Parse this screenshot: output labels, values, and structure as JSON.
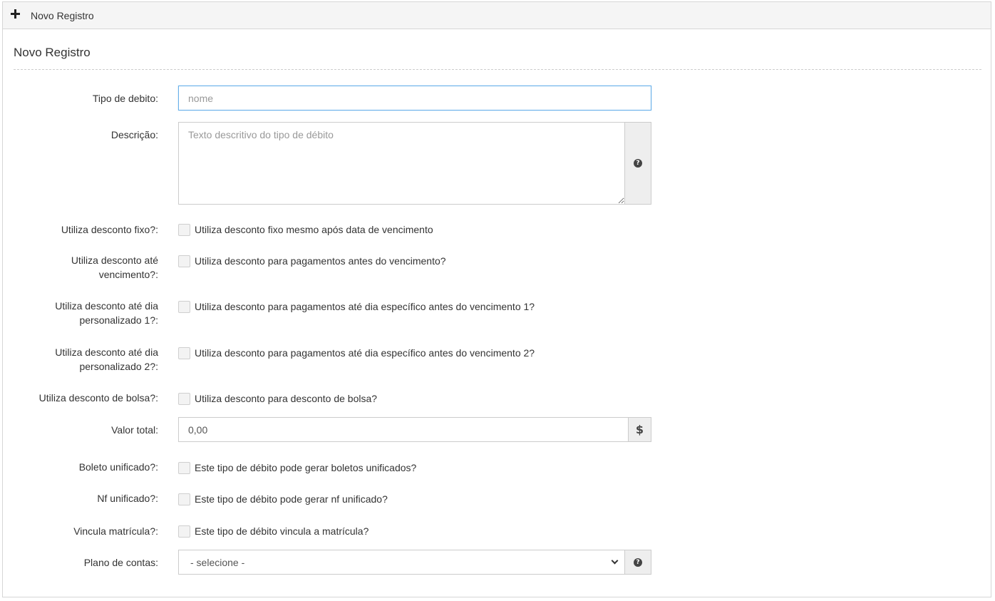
{
  "header": {
    "title": "Novo Registro",
    "icon": "plus-icon"
  },
  "section": {
    "title": "Novo Registro"
  },
  "fields": {
    "tipo_debito": {
      "label": "Tipo de debito:",
      "placeholder": "nome"
    },
    "descricao": {
      "label": "Descrição:",
      "placeholder": "Texto descritivo do tipo de débito",
      "addon_icon": "help-icon"
    },
    "desconto_fixo": {
      "label": "Utiliza desconto fixo?:",
      "text": "Utiliza desconto fixo mesmo após data de vencimento",
      "checked": false
    },
    "desconto_vencimento": {
      "label_line1": "Utiliza desconto até",
      "label_line2": "vencimento?:",
      "text": "Utiliza desconto para pagamentos antes do vencimento?",
      "checked": false
    },
    "desconto_dia1": {
      "label_line1": "Utiliza desconto até dia",
      "label_line2": "personalizado 1?:",
      "text": "Utiliza desconto para pagamentos até dia específico antes do vencimento 1?",
      "checked": false
    },
    "desconto_dia2": {
      "label_line1": "Utiliza desconto até dia",
      "label_line2": "personalizado 2?:",
      "text": "Utiliza desconto para pagamentos até dia específico antes do vencimento 2?",
      "checked": false
    },
    "desconto_bolsa": {
      "label": "Utiliza desconto de bolsa?:",
      "text": "Utiliza desconto para desconto de bolsa?",
      "checked": false
    },
    "valor_total": {
      "label": "Valor total:",
      "value": "0,00",
      "addon_icon": "dollar-icon",
      "addon_text": "$"
    },
    "boleto_unificado": {
      "label": "Boleto unificado?:",
      "text": "Este tipo de débito pode gerar boletos unificados?",
      "checked": false
    },
    "nf_unificado": {
      "label": "Nf unificado?:",
      "text": "Este tipo de débito pode gerar nf unificado?",
      "checked": false
    },
    "vincula_matricula": {
      "label": "Vincula matrícula?:",
      "text": "Este tipo de débito vincula a matrícula?",
      "checked": false
    },
    "plano_contas": {
      "label": "Plano de contas:",
      "selected": "- selecione -",
      "addon_icon": "help-icon"
    }
  },
  "colors": {
    "focus_border": "#66afe9",
    "addon_bg": "#eeeeee",
    "header_bg": "#f5f5f5"
  }
}
